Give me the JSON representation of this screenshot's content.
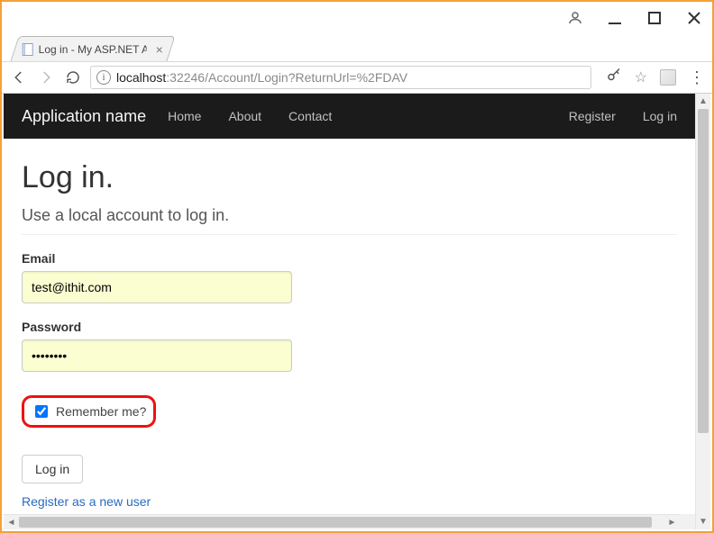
{
  "window": {
    "tab_title": "Log in - My ASP.NET App",
    "url_host": "localhost",
    "url_port": ":32246",
    "url_path": "/Account/Login?ReturnUrl=%2FDAV"
  },
  "navbar": {
    "brand": "Application name",
    "links": [
      "Home",
      "About",
      "Contact"
    ],
    "right": [
      "Register",
      "Log in"
    ]
  },
  "page": {
    "heading": "Log in.",
    "subheading": "Use a local account to log in.",
    "email_label": "Email",
    "email_value": "test@ithit.com",
    "password_label": "Password",
    "password_value": "••••••••",
    "remember_label": "Remember me?",
    "submit_label": "Log in",
    "register_link": "Register as a new user"
  }
}
